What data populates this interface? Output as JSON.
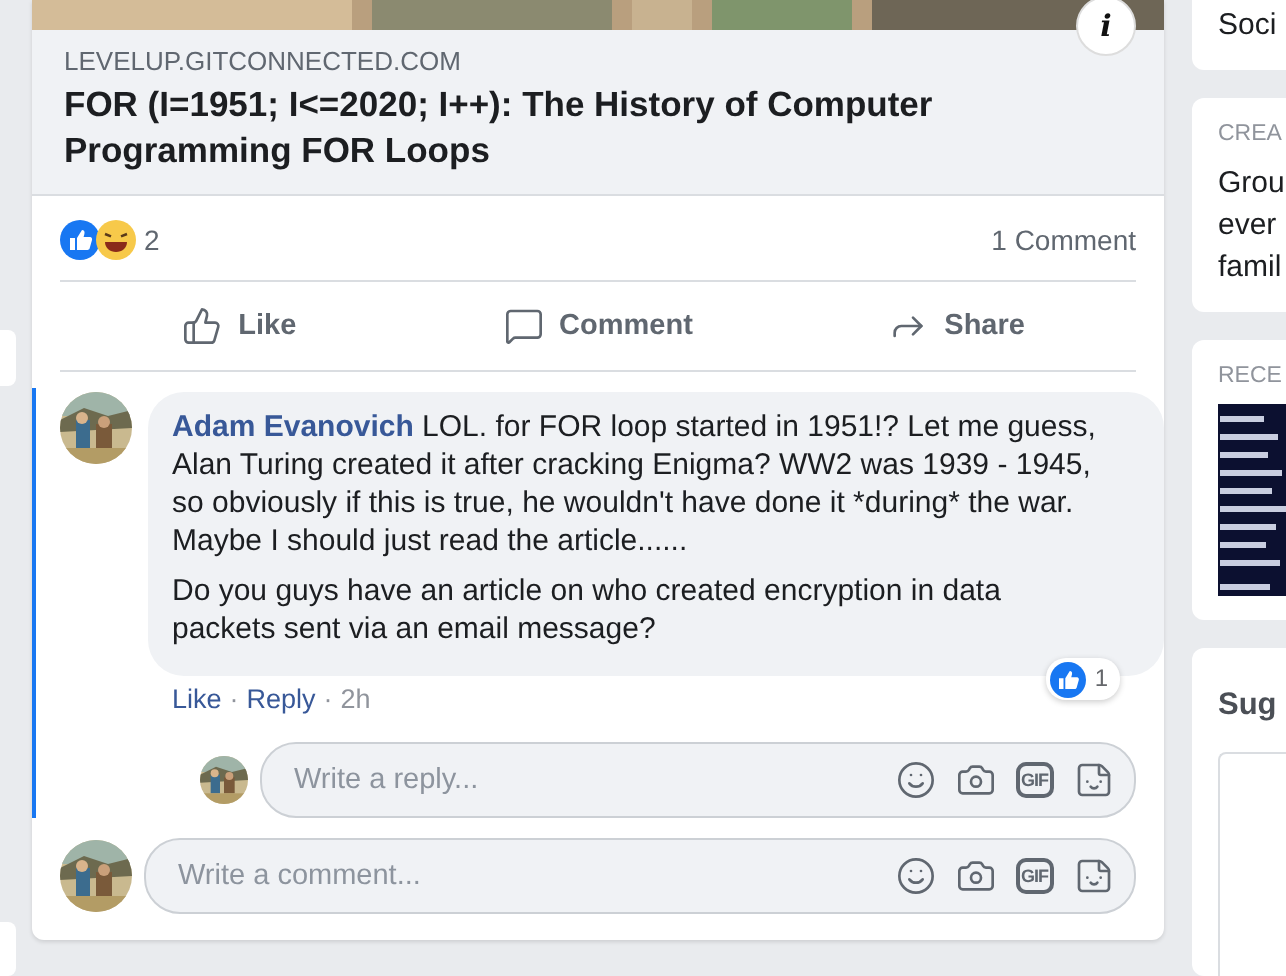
{
  "link_preview": {
    "domain": "LEVELUP.GITCONNECTED.COM",
    "title": "FOR (I=1951; I<=2020; I++): The History of Computer Programming FOR Loops",
    "info": "i"
  },
  "stats": {
    "reaction_count": "2",
    "comments": "1 Comment"
  },
  "actions": [
    {
      "kind": "like",
      "label": "Like"
    },
    {
      "kind": "comment",
      "label": "Comment"
    },
    {
      "kind": "share",
      "label": "Share"
    }
  ],
  "comment": {
    "author": "Adam Evanovich",
    "paragraphs": [
      "LOL. for FOR loop started in 1951!? Let me guess, Alan Turing created it after cracking Enigma? WW2 was 1939 - 1945, so obviously if this is true, he wouldn't have done it *during* the war. Maybe I should just read the article......",
      "Do you guys have an article on who created encryption in data packets sent via an email message?"
    ],
    "links": [
      "Like",
      "Reply"
    ],
    "separator": "·",
    "time": "2h",
    "like_count": "1"
  },
  "reply_box": {
    "placeholder": "Write a reply...",
    "gif": "GIF"
  },
  "comment_box": {
    "placeholder": "Write a comment...",
    "gif": "GIF"
  },
  "sidebar": [
    {
      "kind": "text",
      "lines": [
        "Soci"
      ]
    },
    {
      "kind": "text",
      "heading": "CREA",
      "lines": [
        "Grou",
        "ever",
        "famil"
      ]
    },
    {
      "kind": "picture",
      "heading": "RECE"
    },
    {
      "kind": "title",
      "title": "Sug"
    }
  ]
}
